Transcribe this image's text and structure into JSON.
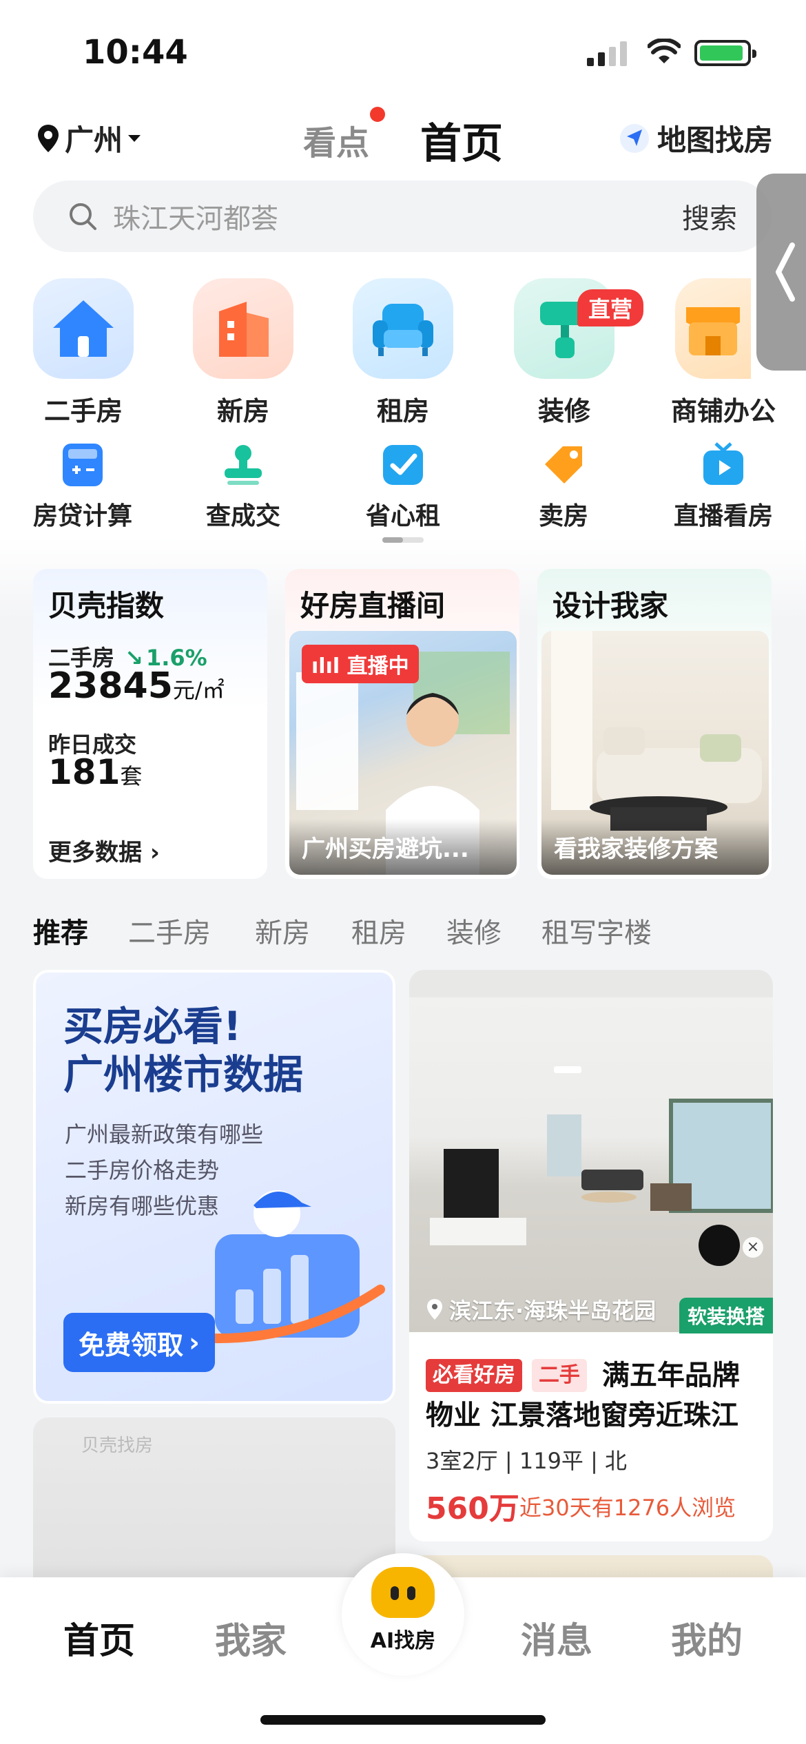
{
  "status_bar": {
    "time": "10:44"
  },
  "header": {
    "city": "广州",
    "tabs": [
      {
        "label": "看点"
      },
      {
        "label": "首页"
      }
    ],
    "map_label": "地图找房"
  },
  "search": {
    "placeholder": "珠江天河都荟",
    "button": "搜索"
  },
  "top_icons": [
    {
      "label": "二手房",
      "icon": "house-icon"
    },
    {
      "label": "新房",
      "icon": "building-icon"
    },
    {
      "label": "租房",
      "icon": "sofa-icon"
    },
    {
      "label": "装修",
      "icon": "paint-roller-icon",
      "badge": "直营"
    },
    {
      "label": "商铺办公",
      "icon": "shop-icon"
    }
  ],
  "small_icons": [
    {
      "label": "房贷计算",
      "icon": "calculator-icon"
    },
    {
      "label": "查成交",
      "icon": "stamp-icon"
    },
    {
      "label": "省心租",
      "icon": "check-box-icon"
    },
    {
      "label": "卖房",
      "icon": "tag-icon"
    },
    {
      "label": "直播看房",
      "icon": "tv-icon"
    }
  ],
  "cards": {
    "index": {
      "title": "贝壳指数",
      "second_hand_label": "二手房",
      "change": "1.6%",
      "price": "23845",
      "price_unit": "元/㎡",
      "deal_label": "昨日成交",
      "deal_count": "181",
      "deal_unit": "套",
      "more": "更多数据"
    },
    "live": {
      "title": "好房直播间",
      "badge": "直播中",
      "caption": "广州买房避坑..."
    },
    "design": {
      "title": "设计我家",
      "caption": "看我家装修方案"
    }
  },
  "feed_tabs": [
    {
      "label": "推荐"
    },
    {
      "label": "二手房"
    },
    {
      "label": "新房"
    },
    {
      "label": "租房"
    },
    {
      "label": "装修"
    },
    {
      "label": "租写字楼"
    }
  ],
  "promo": {
    "title1": "买房必看!",
    "title2": "广州楼市数据",
    "lines": [
      "广州最新政策有哪些",
      "二手房价格走势",
      "新房有哪些优惠"
    ],
    "cta": "免费领取"
  },
  "listing": {
    "location": "滨江东·海珠半岛花园",
    "soft_badge": "软装换搭",
    "tag1": "必看好房",
    "tag2": "二手",
    "title": "满五年品牌物业 江景落地窗旁近珠江",
    "spec": "3室2厅 | 119平 | 北",
    "price": "560万",
    "views": "近30天有1276人浏览"
  },
  "watermark": "贝壳找房",
  "bottom_nav": [
    {
      "label": "首页"
    },
    {
      "label": "我家"
    },
    {
      "label": "AI找房"
    },
    {
      "label": "消息"
    },
    {
      "label": "我的"
    }
  ],
  "colors": {
    "accent_red": "#e53b3b",
    "accent_blue": "#2b6ef3",
    "green": "#1aa06a",
    "brand_yellow": "#f7b500"
  }
}
